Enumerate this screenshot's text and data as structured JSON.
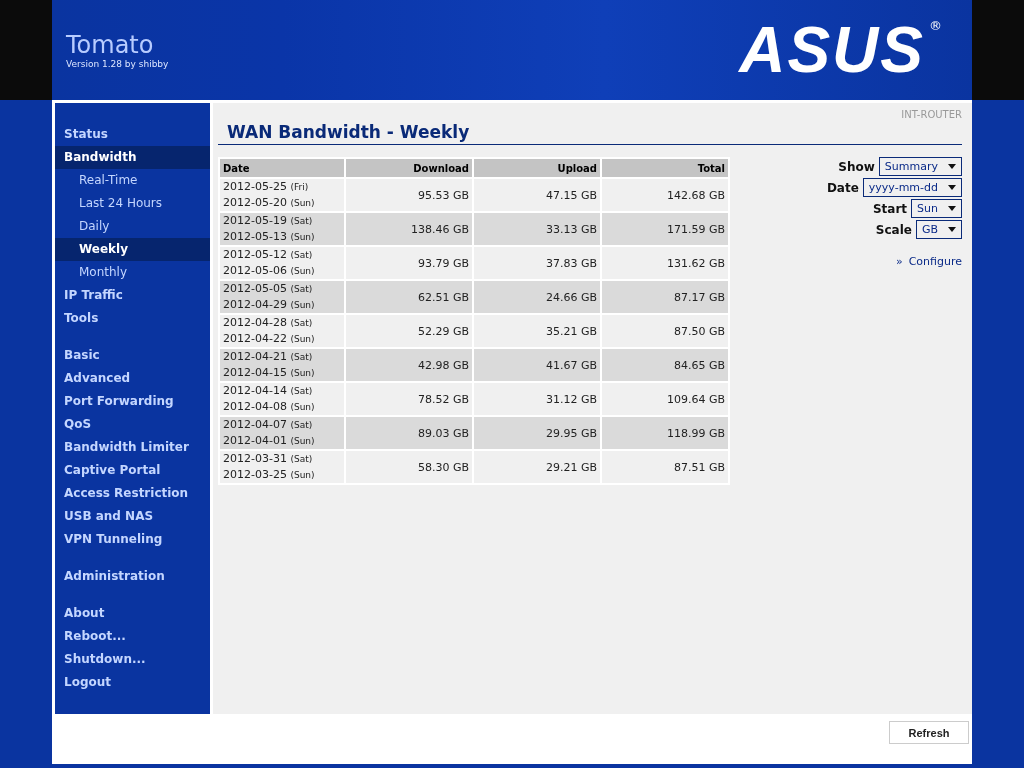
{
  "header": {
    "title": "Tomato",
    "version": "Version 1.28 by shibby",
    "logo": "ASUS",
    "logo_mark": "®"
  },
  "sidebar": {
    "groups": [
      [
        {
          "label": "Status",
          "selected": false
        },
        {
          "label": "Bandwidth",
          "selected": true,
          "children": [
            {
              "label": "Real-Time",
              "selected": false
            },
            {
              "label": "Last 24 Hours",
              "selected": false
            },
            {
              "label": "Daily",
              "selected": false
            },
            {
              "label": "Weekly",
              "selected": true
            },
            {
              "label": "Monthly",
              "selected": false
            }
          ]
        },
        {
          "label": "IP Traffic",
          "selected": false
        },
        {
          "label": "Tools",
          "selected": false
        }
      ],
      [
        {
          "label": "Basic",
          "selected": false
        },
        {
          "label": "Advanced",
          "selected": false
        },
        {
          "label": "Port Forwarding",
          "selected": false
        },
        {
          "label": "QoS",
          "selected": false
        },
        {
          "label": "Bandwidth Limiter",
          "selected": false
        },
        {
          "label": "Captive Portal",
          "selected": false
        },
        {
          "label": "Access Restriction",
          "selected": false
        },
        {
          "label": "USB and NAS",
          "selected": false
        },
        {
          "label": "VPN Tunneling",
          "selected": false
        }
      ],
      [
        {
          "label": "Administration",
          "selected": false
        }
      ],
      [
        {
          "label": "About",
          "selected": false
        },
        {
          "label": "Reboot...",
          "selected": false
        },
        {
          "label": "Shutdown...",
          "selected": false
        },
        {
          "label": "Logout",
          "selected": false
        }
      ]
    ]
  },
  "router_name": "INT-ROUTER",
  "page_title": "WAN Bandwidth - Weekly",
  "table": {
    "columns": [
      "Date",
      "Download",
      "Upload",
      "Total"
    ],
    "rows": [
      {
        "dates": [
          {
            "date": "2012-05-25",
            "day": "(Fri)"
          },
          {
            "date": "2012-05-20",
            "day": "(Sun)"
          }
        ],
        "download": "95.53 GB",
        "upload": "47.15 GB",
        "total": "142.68 GB"
      },
      {
        "dates": [
          {
            "date": "2012-05-19",
            "day": "(Sat)"
          },
          {
            "date": "2012-05-13",
            "day": "(Sun)"
          }
        ],
        "download": "138.46 GB",
        "upload": "33.13 GB",
        "total": "171.59 GB"
      },
      {
        "dates": [
          {
            "date": "2012-05-12",
            "day": "(Sat)"
          },
          {
            "date": "2012-05-06",
            "day": "(Sun)"
          }
        ],
        "download": "93.79 GB",
        "upload": "37.83 GB",
        "total": "131.62 GB"
      },
      {
        "dates": [
          {
            "date": "2012-05-05",
            "day": "(Sat)"
          },
          {
            "date": "2012-04-29",
            "day": "(Sun)"
          }
        ],
        "download": "62.51 GB",
        "upload": "24.66 GB",
        "total": "87.17 GB"
      },
      {
        "dates": [
          {
            "date": "2012-04-28",
            "day": "(Sat)"
          },
          {
            "date": "2012-04-22",
            "day": "(Sun)"
          }
        ],
        "download": "52.29 GB",
        "upload": "35.21 GB",
        "total": "87.50 GB"
      },
      {
        "dates": [
          {
            "date": "2012-04-21",
            "day": "(Sat)"
          },
          {
            "date": "2012-04-15",
            "day": "(Sun)"
          }
        ],
        "download": "42.98 GB",
        "upload": "41.67 GB",
        "total": "84.65 GB"
      },
      {
        "dates": [
          {
            "date": "2012-04-14",
            "day": "(Sat)"
          },
          {
            "date": "2012-04-08",
            "day": "(Sun)"
          }
        ],
        "download": "78.52 GB",
        "upload": "31.12 GB",
        "total": "109.64 GB"
      },
      {
        "dates": [
          {
            "date": "2012-04-07",
            "day": "(Sat)"
          },
          {
            "date": "2012-04-01",
            "day": "(Sun)"
          }
        ],
        "download": "89.03 GB",
        "upload": "29.95 GB",
        "total": "118.99 GB"
      },
      {
        "dates": [
          {
            "date": "2012-03-31",
            "day": "(Sat)"
          },
          {
            "date": "2012-03-25",
            "day": "(Sun)"
          }
        ],
        "download": "58.30 GB",
        "upload": "29.21 GB",
        "total": "87.51 GB"
      }
    ]
  },
  "options": [
    {
      "label": "Show",
      "value": "Summary"
    },
    {
      "label": "Date",
      "value": "yyyy-mm-dd"
    },
    {
      "label": "Start",
      "value": "Sun"
    },
    {
      "label": "Scale",
      "value": "GB"
    }
  ],
  "configure_link": {
    "prefix": "»",
    "label": "Configure"
  },
  "refresh_button": "Refresh"
}
